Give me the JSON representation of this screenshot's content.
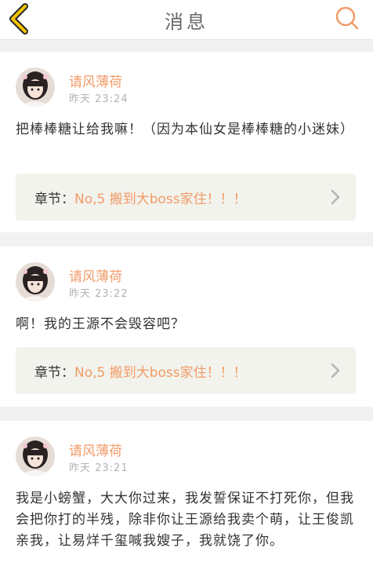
{
  "header": {
    "title": "消息",
    "back_icon": "chevron-left-icon",
    "search_icon": "search-icon",
    "accent_color": "#f5c400",
    "search_color": "#f29b68"
  },
  "messages": [
    {
      "username": "请风薄荷",
      "time": "昨天 23:24",
      "content": "把棒棒糖让给我嘛！（因为本仙女是棒棒糖的小迷妹）",
      "chapter_prefix": "章节：",
      "chapter_title": "No,5 搬到大boss家住！！！"
    },
    {
      "username": "请风薄荷",
      "time": "昨天 23:22",
      "content": "啊！我的王源不会毁容吧？",
      "chapter_prefix": "章节：",
      "chapter_title": "No,5 搬到大boss家住！！！"
    },
    {
      "username": "请风薄荷",
      "time": "昨天 23:21",
      "content": "我是小螃蟹，大大你过来，我发誓保证不打死你，但我会把你打的半残，除非你让王源给我卖个萌，让王俊凯亲我，让易烊千玺喊我嫂子，我就饶了你。"
    }
  ]
}
